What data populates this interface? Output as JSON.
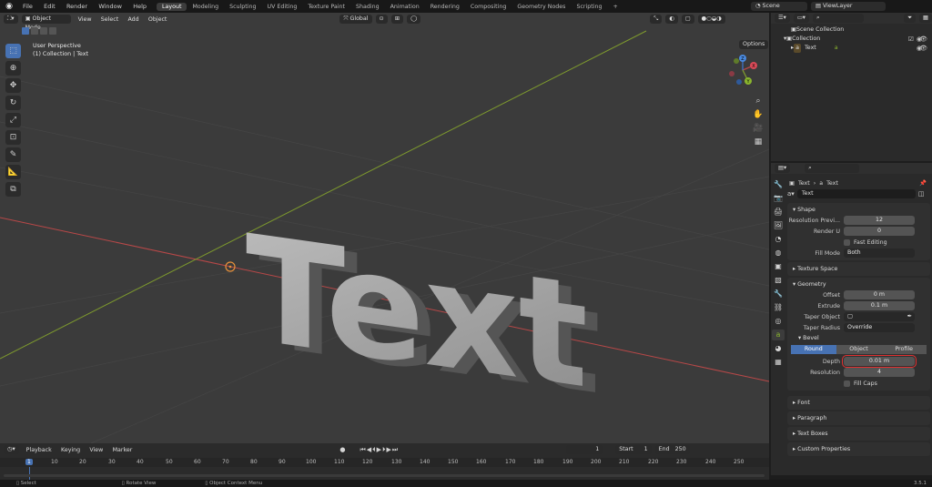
{
  "topbar": {
    "menus": [
      "File",
      "Edit",
      "Render",
      "Window",
      "Help"
    ],
    "workspaces": [
      "Layout",
      "Modeling",
      "Sculpting",
      "UV Editing",
      "Texture Paint",
      "Shading",
      "Animation",
      "Rendering",
      "Compositing",
      "Geometry Nodes",
      "Scripting"
    ],
    "active_workspace": "Layout",
    "scene": "Scene",
    "view_layer": "ViewLayer"
  },
  "viewport": {
    "mode": "Object Mode",
    "menus": [
      "View",
      "Select",
      "Add",
      "Object"
    ],
    "orientation": "Global",
    "options": "Options",
    "info_line1": "User Perspective",
    "info_line2": "(1) Collection | Text",
    "text_object": "Text",
    "tools": [
      "cursor-tool",
      "select-tool",
      "move-tool",
      "rotate-tool",
      "scale-tool",
      "transform-tool",
      "annotate-tool",
      "measure-tool",
      "add-cube-tool"
    ],
    "gizmo": {
      "x": "X",
      "y": "Y",
      "z": "Z"
    }
  },
  "outliner": {
    "scene_collection": "Scene Collection",
    "collection": "Collection",
    "object": "Text"
  },
  "properties": {
    "breadcrumb_1": "Text",
    "breadcrumb_2": "Text",
    "datablock": "Text",
    "shape": {
      "header": "Shape",
      "res_preview_label": "Resolution Previ...",
      "res_preview": "12",
      "render_u_label": "Render U",
      "render_u": "0",
      "fast_editing": "Fast Editing",
      "fill_mode_label": "Fill Mode",
      "fill_mode": "Both"
    },
    "texture_space": "Texture Space",
    "geometry": {
      "header": "Geometry",
      "offset_label": "Offset",
      "offset": "0 m",
      "extrude_label": "Extrude",
      "extrude": "0.1 m",
      "taper_object_label": "Taper Object",
      "taper_radius_label": "Taper Radius",
      "taper_radius": "Override"
    },
    "bevel": {
      "header": "Bevel",
      "modes": [
        "Round",
        "Object",
        "Profile"
      ],
      "active_mode": "Round",
      "depth_label": "Depth",
      "depth": "0.01 m",
      "resolution_label": "Resolution",
      "resolution": "4",
      "fill_caps": "Fill Caps"
    },
    "collapsed": [
      "Font",
      "Paragraph",
      "Text Boxes",
      "Custom Properties"
    ]
  },
  "timeline": {
    "menus": [
      "Playback",
      "Keying",
      "View",
      "Marker"
    ],
    "current_frame": "1",
    "start_label": "Start",
    "start": "1",
    "end_label": "End",
    "end": "250",
    "ticks": [
      "1",
      "10",
      "20",
      "30",
      "40",
      "50",
      "60",
      "70",
      "80",
      "90",
      "100",
      "110",
      "120",
      "130",
      "140",
      "150",
      "160",
      "170",
      "180",
      "190",
      "200",
      "210",
      "220",
      "230",
      "240",
      "250"
    ]
  },
  "status": {
    "select": "Select",
    "rotate": "Rotate View",
    "context": "Object Context Menu",
    "version": "3.5.1"
  },
  "colors": {
    "accent": "#4772b3",
    "highlight_box": "#e03030",
    "x_axis": "#b84848",
    "y_axis": "#7e9a2e"
  }
}
